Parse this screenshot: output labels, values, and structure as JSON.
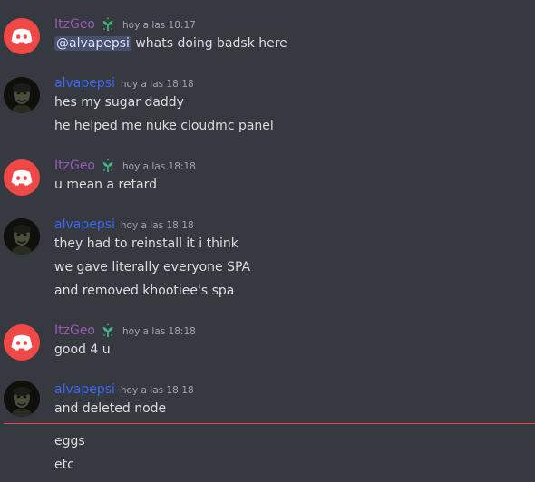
{
  "colors": {
    "background": "#36393f",
    "itzgeo_name": "#9b59b6",
    "alvapepsi_name": "#3a68f5",
    "timestamp": "#a3a6aa",
    "message_text": "#dcddde",
    "mention_bg": "#4a5280",
    "discord_avatar": "#f04747",
    "badge_green": "#43b581",
    "new_messages_divider": "#f04747"
  },
  "messages": [
    {
      "author": "ItzGeo",
      "timestamp": "hoy a las 18:17",
      "badge": "sprout-icon",
      "lines": [
        {
          "mention": "@alvapepsi",
          "text": " whats doing badsk here"
        }
      ]
    },
    {
      "author": "alvapepsi",
      "timestamp": "hoy a las 18:18",
      "lines": [
        "hes my sugar daddy",
        "he helped me nuke cloudmc panel"
      ]
    },
    {
      "author": "ItzGeo",
      "timestamp": "hoy a las 18:18",
      "badge": "sprout-icon",
      "lines": [
        "u mean a retard"
      ]
    },
    {
      "author": "alvapepsi",
      "timestamp": "hoy a las 18:18",
      "lines": [
        "they had to reinstall it i think",
        "we gave literally everyone SPA",
        "and removed khootiee's spa"
      ]
    },
    {
      "author": "ItzGeo",
      "timestamp": "hoy a las 18:18",
      "badge": "sprout-icon",
      "lines": [
        "good 4 u"
      ]
    },
    {
      "author": "alvapepsi",
      "timestamp": "hoy a las 18:18",
      "lines": [
        "and deleted node"
      ]
    }
  ],
  "after_divider": [
    "eggs",
    "etc"
  ]
}
